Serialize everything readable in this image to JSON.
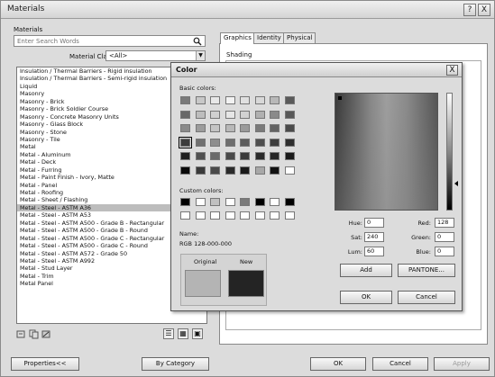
{
  "window": {
    "title": "Materials",
    "help_label": "?",
    "close_label": "X"
  },
  "left": {
    "materials_label": "Materials",
    "search_placeholder": "Enter Search Words",
    "material_class_label": "Material Class:",
    "material_class_value": "<All>",
    "items": [
      "Insulation / Thermal Barriers - Rigid insulation",
      "Insulation / Thermal Barriers - Semi-rigid insulation",
      "Liquid",
      "Masonry",
      "Masonry - Brick",
      "Masonry - Brick Soldier Course",
      "Masonry - Concrete Masonry Units",
      "Masonry - Glass Block",
      "Masonry - Stone",
      "Masonry - Tile",
      "Metal",
      "Metal - Aluminum",
      "Metal - Deck",
      "Metal - Furring",
      "Metal - Paint Finish - Ivory, Matte",
      "Metal - Panel",
      "Metal - Roofing",
      "Metal - Sheet / Flashing",
      "Metal - Steel - ASTM A36",
      "Metal - Steel - ASTM A53",
      "Metal - Steel - ASTM A500 - Grade B - Rectangular",
      "Metal - Steel - ASTM A500 - Grade B - Round",
      "Metal - Steel - ASTM A500 - Grade C - Rectangular",
      "Metal - Steel - ASTM A500 - Grade C - Round",
      "Metal - Steel - ASTM A572 - Grade 50",
      "Metal - Steel - ASTM A992",
      "Metal - Stud Layer",
      "Metal - Trim",
      "Metal Panel"
    ],
    "selected_index": 18,
    "tool_icons": [
      "new-material-icon",
      "duplicate-icon",
      "rename-icon"
    ],
    "view_icons": [
      "list-view-icon",
      "thumbnail-view-icon",
      "large-thumbnail-view-icon"
    ]
  },
  "tabs": [
    "Graphics",
    "Identity",
    "Physical"
  ],
  "active_tab": "Graphics",
  "graphics": {
    "shading_label": "Shading"
  },
  "color_dialog": {
    "title": "Color",
    "close_label": "X",
    "basic_colors_label": "Basic colors:",
    "custom_colors_label": "Custom colors:",
    "name_label": "Name:",
    "name_value": "RGB 128-000-000",
    "original_label": "Original",
    "new_label": "New",
    "original_color": "#b4b4b4",
    "new_color": "#242424",
    "hue_label": "Hue:",
    "hue_value": "0",
    "sat_label": "Sat:",
    "sat_value": "240",
    "lum_label": "Lum:",
    "lum_value": "60",
    "red_label": "Red:",
    "red_value": "128",
    "green_label": "Green:",
    "green_value": "0",
    "blue_label": "Blue:",
    "blue_value": "0",
    "add_label": "Add",
    "pantone_label": "PANTONE...",
    "ok_label": "OK",
    "cancel_label": "Cancel",
    "basic_colors": [
      [
        "#7a7a7a",
        "#c8c8c8",
        "#e8e8e8",
        "#f2f2f2",
        "#e0e0e0",
        "#d8d8d8",
        "#b8b8b8",
        "#5a5a5a"
      ],
      [
        "#686868",
        "#bdbdbd",
        "#d0d0d0",
        "#e6e6e6",
        "#d2d2d2",
        "#b0b0b0",
        "#8a8a8a",
        "#585858"
      ],
      [
        "#8a8a8a",
        "#9c9c9c",
        "#c4c4c4",
        "#b8b8b8",
        "#9a9a9a",
        "#7a7a7a",
        "#626262",
        "#4a4a4a"
      ],
      [
        "#3c3c3c",
        "#707070",
        "#8e8e8e",
        "#6e6e6e",
        "#5c5c5c",
        "#4e4e4e",
        "#3e3e3e",
        "#2e2e2e"
      ],
      [
        "#1e1e1e",
        "#505050",
        "#6a6a6a",
        "#4a4a4a",
        "#3a3a3a",
        "#2a2a2a",
        "#262626",
        "#1a1a1a"
      ],
      [
        "#0a0a0a",
        "#3a3a3a",
        "#4a4a4a",
        "#2a2a2a",
        "#1a1a1a",
        "#a8a8a8",
        "#111111",
        "#ffffff"
      ]
    ],
    "selected_basic": [
      3,
      0
    ],
    "custom_colors": [
      [
        "#000000",
        "#ffffff",
        "#c0c0c0",
        "#ffffff",
        "#7a7a7a",
        "#000000",
        "#ffffff",
        "#000000"
      ],
      [
        "#ffffff",
        "#ffffff",
        "#ffffff",
        "#ffffff",
        "#ffffff",
        "#ffffff",
        "#ffffff",
        "#ffffff"
      ]
    ]
  },
  "footer": {
    "properties_label": "Properties<<",
    "by_category_label": "By Category",
    "ok_label": "OK",
    "cancel_label": "Cancel",
    "apply_label": "Apply"
  }
}
